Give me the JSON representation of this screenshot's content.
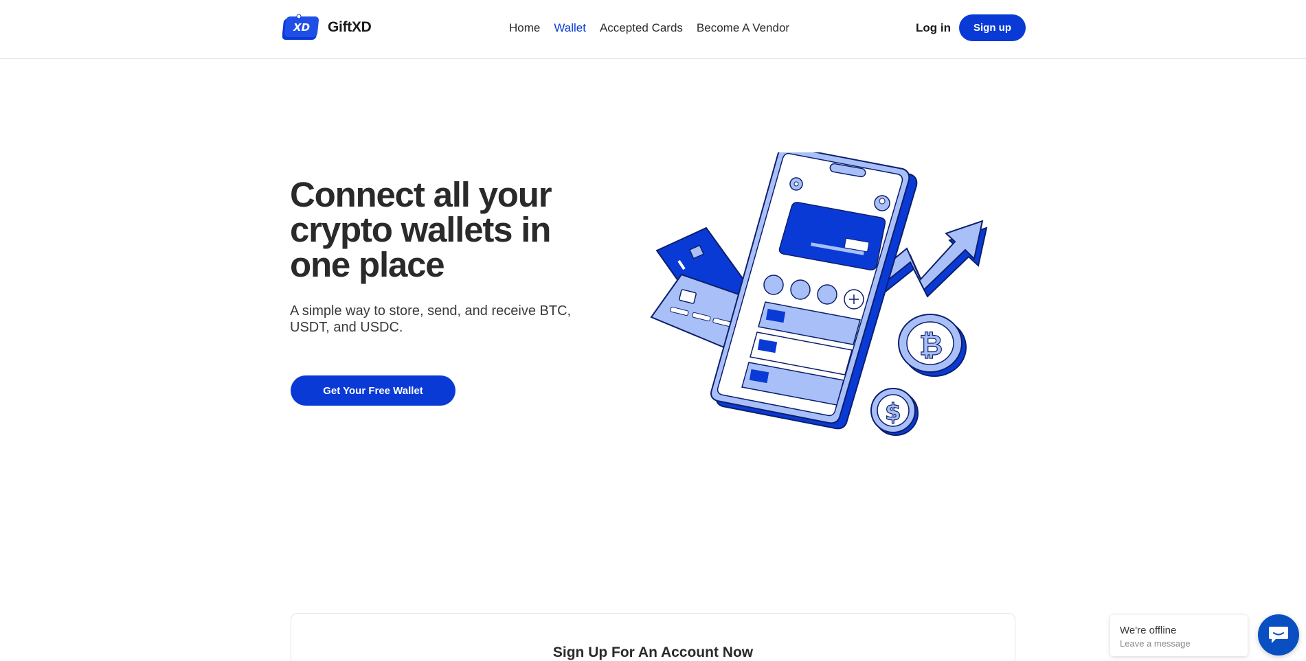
{
  "brand": {
    "name": "GiftXD",
    "logo_text": "XD"
  },
  "nav": {
    "items": [
      {
        "label": "Home",
        "active": false
      },
      {
        "label": "Wallet",
        "active": true
      },
      {
        "label": "Accepted Cards",
        "active": false
      },
      {
        "label": "Become A Vendor",
        "active": false
      }
    ]
  },
  "auth": {
    "login_label": "Log in",
    "signup_label": "Sign up"
  },
  "hero": {
    "title": "Connect all your crypto wallets in one place",
    "subtitle": "A simple way to store, send, and receive BTC, USDT, and USDC.",
    "cta_label": "Get Your Free Wallet",
    "illustration_icons": [
      "phone-wallet-illustration",
      "credit-card-icon",
      "bitcoin-coin-icon",
      "dollar-coin-icon",
      "trend-arrow-icon"
    ]
  },
  "signup_section": {
    "title": "Sign Up For An Account Now"
  },
  "chat": {
    "status": "We're offline",
    "hint": "Leave a message",
    "icon": "chat-icon"
  },
  "colors": {
    "accent": "#0a3ad6",
    "accent_light": "#a9bff7",
    "text": "#2a2a2a"
  }
}
